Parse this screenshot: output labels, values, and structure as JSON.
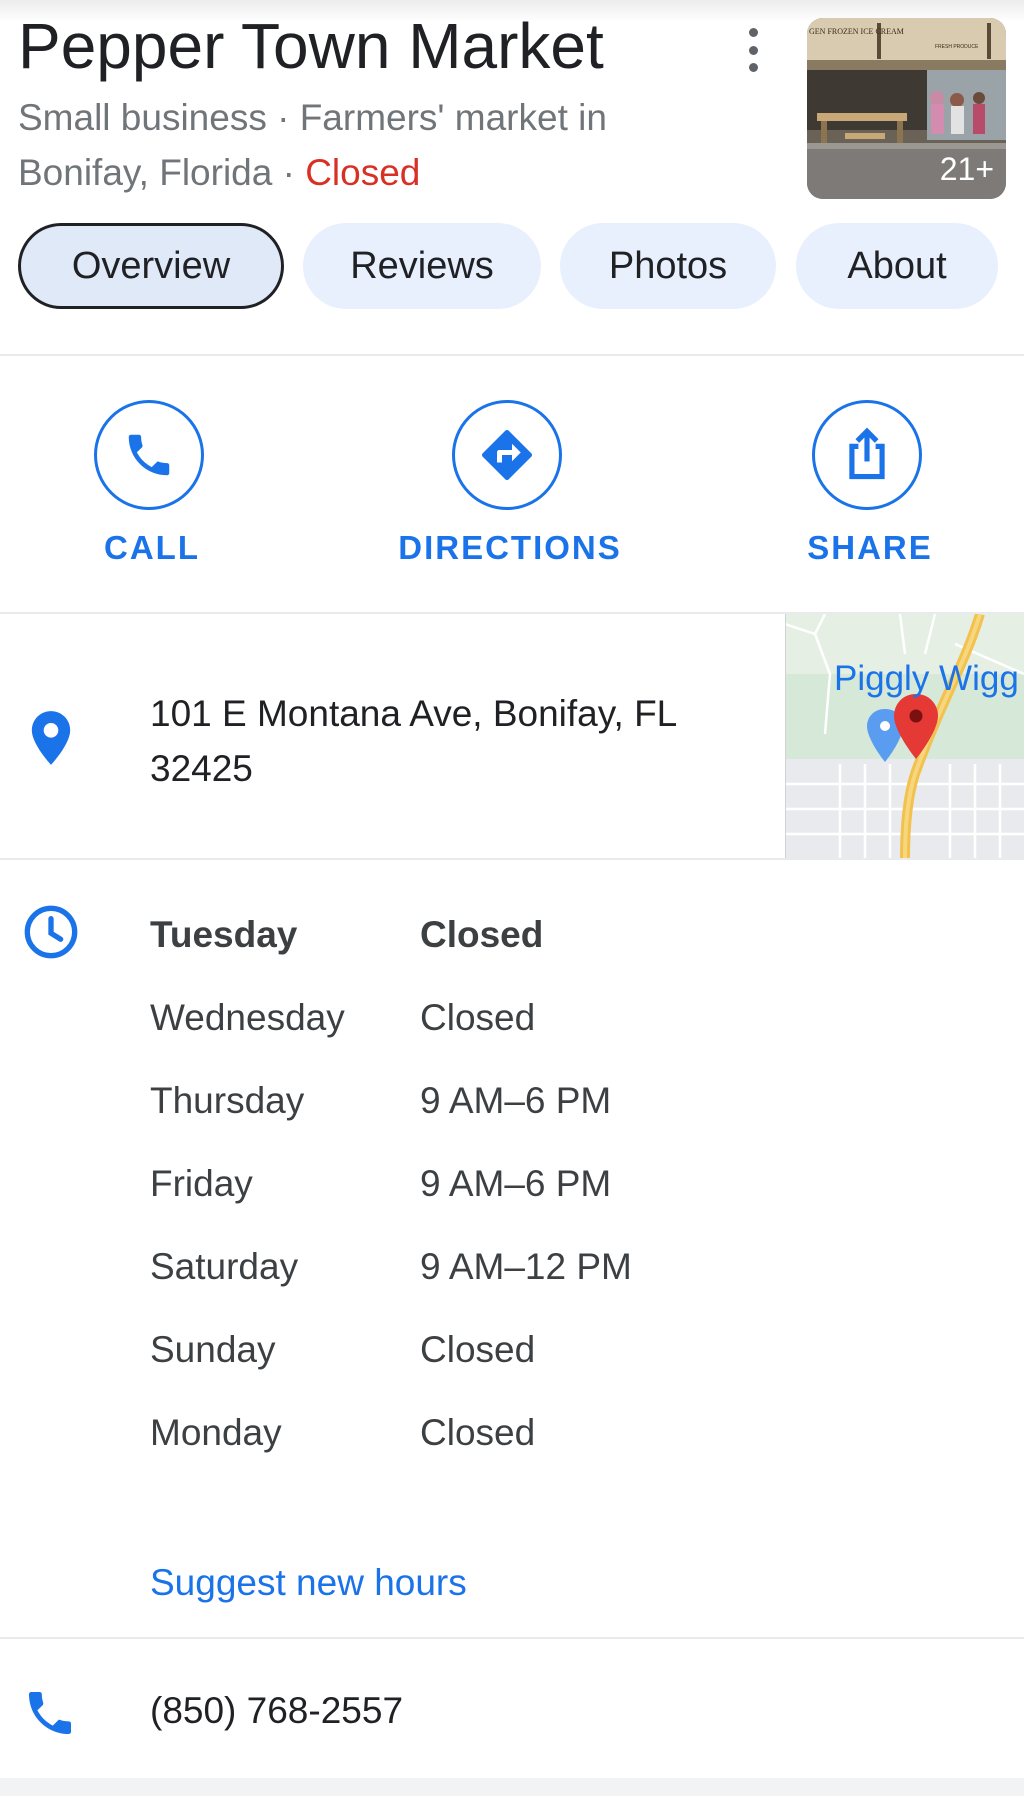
{
  "business": {
    "name": "Pepper Town Market",
    "category_line": "Small business · Farmers' market in",
    "location_line": "Bonifay, Florida · ",
    "status": "Closed",
    "photo_count": "21+",
    "photo_sign_left": "GEN FROZEN ICE CREAM",
    "photo_sign_right": "FRESH PRODUCE"
  },
  "tabs": [
    {
      "label": "Overview"
    },
    {
      "label": "Reviews"
    },
    {
      "label": "Photos"
    },
    {
      "label": "About"
    }
  ],
  "actions": {
    "call": "CALL",
    "directions": "DIRECTIONS",
    "share": "SHARE"
  },
  "address": {
    "line1": "101 E Montana Ave, Bonifay, FL",
    "line2": "32425",
    "map_poi": "Piggly Wigg"
  },
  "hours": [
    {
      "day": "Tuesday",
      "time": "Closed"
    },
    {
      "day": "Wednesday",
      "time": "Closed"
    },
    {
      "day": "Thursday",
      "time": "9 AM–6 PM"
    },
    {
      "day": "Friday",
      "time": "9 AM–6 PM"
    },
    {
      "day": "Saturday",
      "time": "9 AM–12 PM"
    },
    {
      "day": "Sunday",
      "time": "Closed"
    },
    {
      "day": "Monday",
      "time": "Closed"
    }
  ],
  "suggest_hours": "Suggest new hours",
  "phone": "(850) 768-2557",
  "colors": {
    "accent": "#1a73e8",
    "closed": "#d93025",
    "chip_bg": "#e8f0fe"
  },
  "icons": {
    "menu": "more-vert-icon",
    "call": "phone-icon",
    "directions": "directions-icon",
    "share": "share-icon",
    "address": "location-pin-icon",
    "hours": "clock-icon",
    "phone": "phone-icon"
  }
}
